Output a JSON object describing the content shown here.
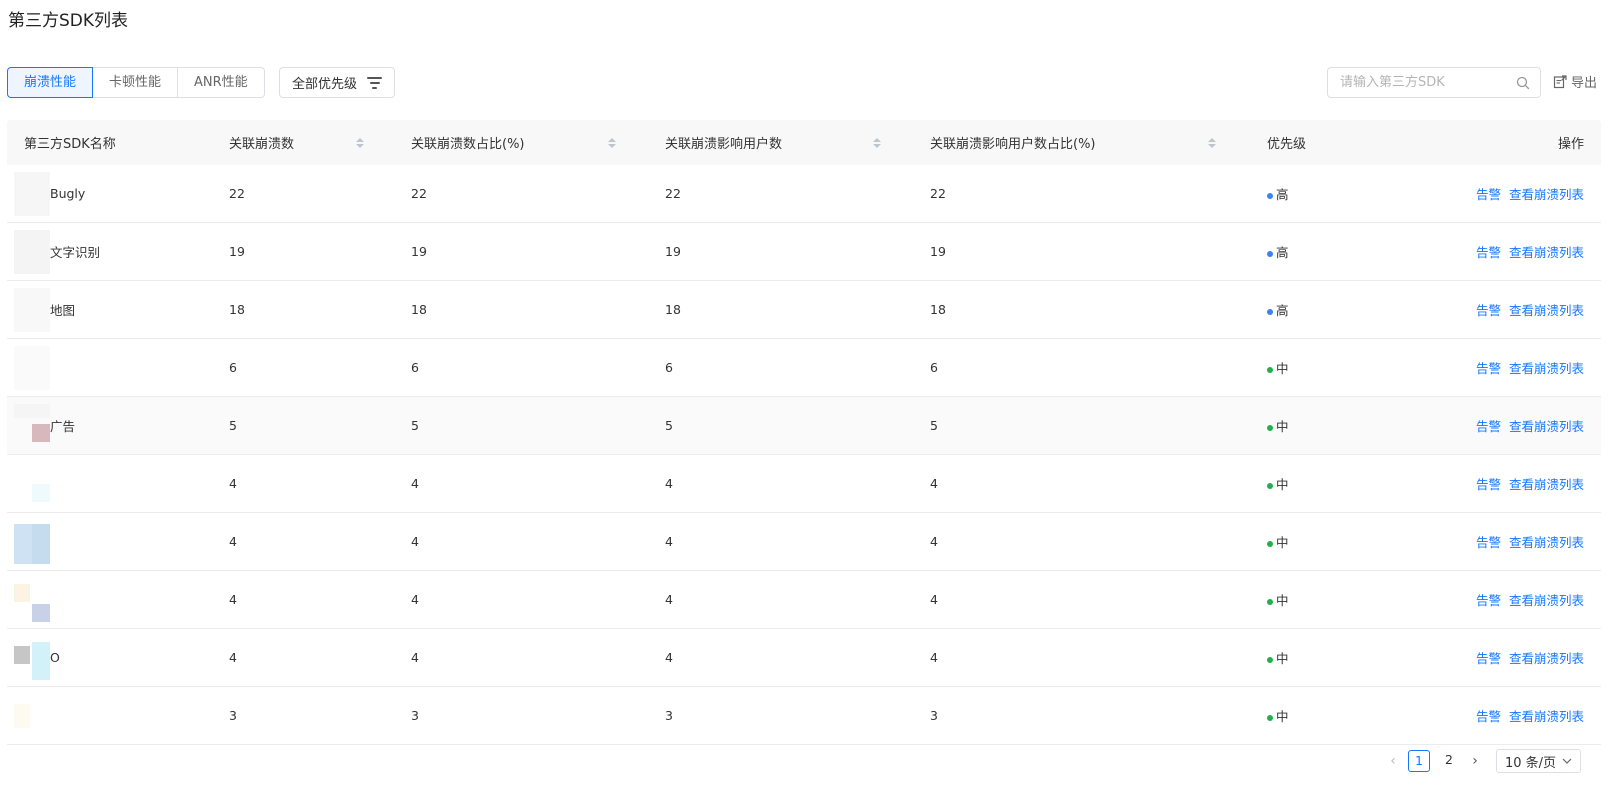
{
  "page": {
    "title": "第三方SDK列表"
  },
  "tabs": [
    {
      "label": "崩溃性能",
      "active": true
    },
    {
      "label": "卡顿性能",
      "active": false
    },
    {
      "label": "ANR性能",
      "active": false
    }
  ],
  "filter": {
    "label": "全部优先级",
    "icon": "filter-lines-icon"
  },
  "search": {
    "placeholder": "请输入第三方SDK",
    "icon": "search-icon"
  },
  "export": {
    "label": "导出",
    "icon": "export-icon"
  },
  "table": {
    "columns": [
      "第三方SDK名称",
      "关联崩溃数",
      "关联崩溃数占比(%)",
      "关联崩溃影响用户数",
      "关联崩溃影响用户数占比(%)",
      "优先级",
      "操作"
    ],
    "action_labels": {
      "alert": "告警",
      "view": "查看崩溃列表"
    },
    "priority_colors": {
      "高": "#3b82f6",
      "中": "#22b04b"
    },
    "rows": [
      {
        "name": "Bugly",
        "crash_count": "22",
        "crash_pct": "22",
        "users": "22",
        "users_pct": "22",
        "priority": "高"
      },
      {
        "name": "文字识别",
        "crash_count": "19",
        "crash_pct": "19",
        "users": "19",
        "users_pct": "19",
        "priority": "高"
      },
      {
        "name": "地图",
        "crash_count": "18",
        "crash_pct": "18",
        "users": "18",
        "users_pct": "18",
        "priority": "高"
      },
      {
        "name": "",
        "crash_count": "6",
        "crash_pct": "6",
        "users": "6",
        "users_pct": "6",
        "priority": "中"
      },
      {
        "name": "广告",
        "crash_count": "5",
        "crash_pct": "5",
        "users": "5",
        "users_pct": "5",
        "priority": "中"
      },
      {
        "name": "",
        "crash_count": "4",
        "crash_pct": "4",
        "users": "4",
        "users_pct": "4",
        "priority": "中"
      },
      {
        "name": "",
        "crash_count": "4",
        "crash_pct": "4",
        "users": "4",
        "users_pct": "4",
        "priority": "中"
      },
      {
        "name": "",
        "crash_count": "4",
        "crash_pct": "4",
        "users": "4",
        "users_pct": "4",
        "priority": "中"
      },
      {
        "name": "O",
        "crash_count": "4",
        "crash_pct": "4",
        "users": "4",
        "users_pct": "4",
        "priority": "中"
      },
      {
        "name": "",
        "crash_count": "3",
        "crash_pct": "3",
        "users": "3",
        "users_pct": "3",
        "priority": "中"
      }
    ]
  },
  "pagination": {
    "pages": [
      "1",
      "2"
    ],
    "current": "1",
    "page_size": "10 条/页"
  }
}
